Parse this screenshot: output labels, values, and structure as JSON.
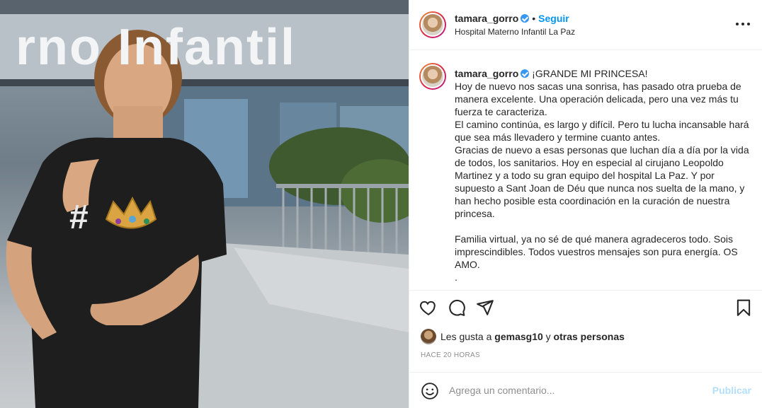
{
  "post": {
    "username": "tamara_gorro",
    "follow_label": "Seguir",
    "separator": "•",
    "location": "Hospital Materno Infantil La Paz",
    "more_icon": "more-horizontal-icon",
    "photo": {
      "sign_text": "rno Infantil",
      "shirt_hash": "#"
    }
  },
  "caption": {
    "username": "tamara_gorro",
    "first_line": "¡GRANDE MI PRINCESA!",
    "paragraphs": [
      "Hoy de nuevo nos sacas una sonrisa, has pasado otra prueba de manera excelente. Una operación delicada, pero una vez más tu fuerza te caracteriza.",
      "El camino continúa, es largo y difícil. Pero tu lucha incansable hará que sea más llevadero y termine cuanto antes.",
      "Gracias de nuevo a esas personas que luchan día a día por la vida de todos, los sanitarios. Hoy en especial al cirujano Leopoldo Martinez y a todo su gran equipo del hospital La Paz. Y por supuesto a Sant Joan de Déu que nunca nos suelta de la mano, y han hecho posible esta coordinación en la curación de nuestra princesa.",
      "Familia virtual, ya no sé de qué manera agradeceros todo. Sois imprescindibles. Todos vuestros mensajes son pura energía. OS AMO.",
      "."
    ]
  },
  "actions": {
    "like_icon": "heart-icon",
    "comment_icon": "comment-icon",
    "share_icon": "paper-plane-icon",
    "save_icon": "bookmark-icon"
  },
  "likes": {
    "prefix": "Les gusta a",
    "user": "gemasg10",
    "joiner": "y",
    "others": "otras personas"
  },
  "timestamp": "HACE 20 HORAS",
  "comment": {
    "placeholder": "Agrega un comentario...",
    "publish_label": "Publicar",
    "emoji_icon": "smiley-icon"
  },
  "colors": {
    "accent": "#0095f6",
    "publish_disabled": "#b2dffc",
    "verified": "#3897f0",
    "text": "#262626",
    "muted": "#8e8e8e"
  }
}
